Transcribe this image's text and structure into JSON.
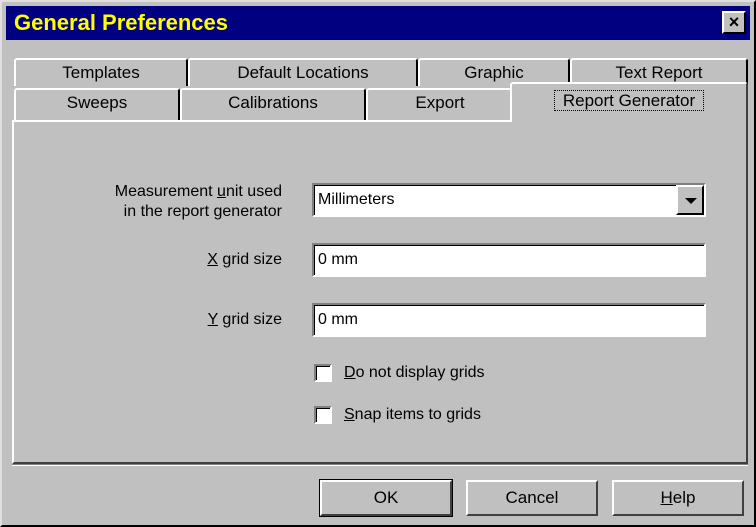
{
  "window": {
    "title": "General Preferences",
    "close_glyph": "×"
  },
  "tabs_back_row": [
    {
      "label": "Templates"
    },
    {
      "label": "Default Locations"
    },
    {
      "label": "Graphic"
    },
    {
      "label": "Text Report"
    }
  ],
  "tabs_front_row": [
    {
      "label": "Sweeps"
    },
    {
      "label": "Calibrations"
    },
    {
      "label": "Export"
    },
    {
      "label": "Report Generator",
      "active": true
    }
  ],
  "form": {
    "unit_label_line1_pre": "Measurement ",
    "unit_label_line1_ul": "u",
    "unit_label_line1_post": "nit used",
    "unit_label_line2": "in the report generator",
    "unit_value": "Millimeters",
    "xgrid_label_ul": "X",
    "xgrid_label_post": " grid size",
    "xgrid_value": "0 mm",
    "ygrid_label_ul": "Y",
    "ygrid_label_post": " grid size",
    "ygrid_value": "0 mm",
    "no_grid_ul": "D",
    "no_grid_post": "o not display grids",
    "no_grid_checked": false,
    "snap_ul": "S",
    "snap_post": "nap items to grids",
    "snap_checked": false
  },
  "buttons": {
    "ok": "OK",
    "cancel": "Cancel",
    "help_ul": "H",
    "help_post": "elp"
  },
  "colors": {
    "titlebar_bg": "#000080",
    "title_text": "#ffff00",
    "face": "#c0c0c0"
  }
}
